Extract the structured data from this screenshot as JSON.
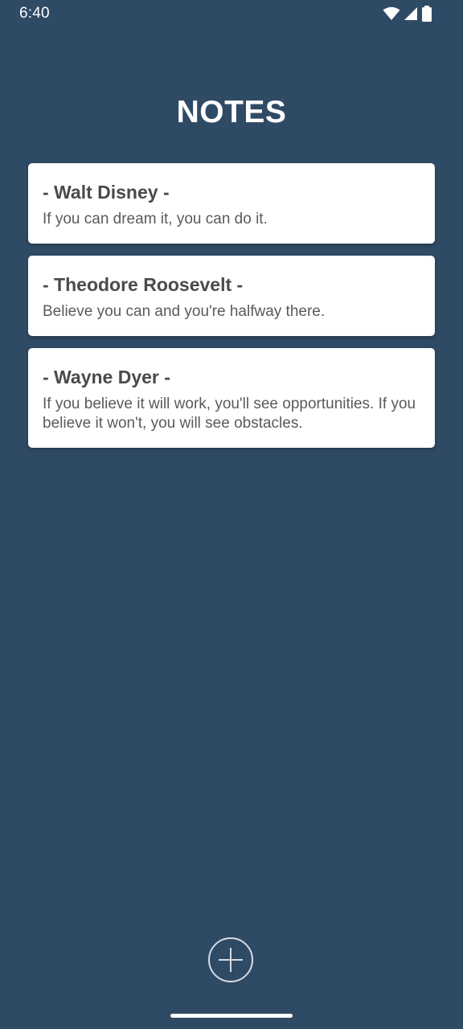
{
  "status_bar": {
    "time": "6:40",
    "icons": [
      "wifi-icon",
      "cellular-signal-icon",
      "battery-icon"
    ]
  },
  "header": {
    "title": "NOTES"
  },
  "notes": [
    {
      "title": "- Walt Disney -",
      "body": "If you can dream it, you can do it."
    },
    {
      "title": "- Theodore Roosevelt -",
      "body": "Believe you can and you're halfway there."
    },
    {
      "title": "- Wayne Dyer -",
      "body": "If you believe it will work, you'll see opportunities. If you believe it won't, you will see obstacles."
    }
  ],
  "fab": {
    "icon": "plus-icon"
  },
  "colors": {
    "background": "#2f4a65",
    "card": "#ffffff",
    "card_title": "#4a4a4a",
    "card_body": "#5a5a5a"
  }
}
